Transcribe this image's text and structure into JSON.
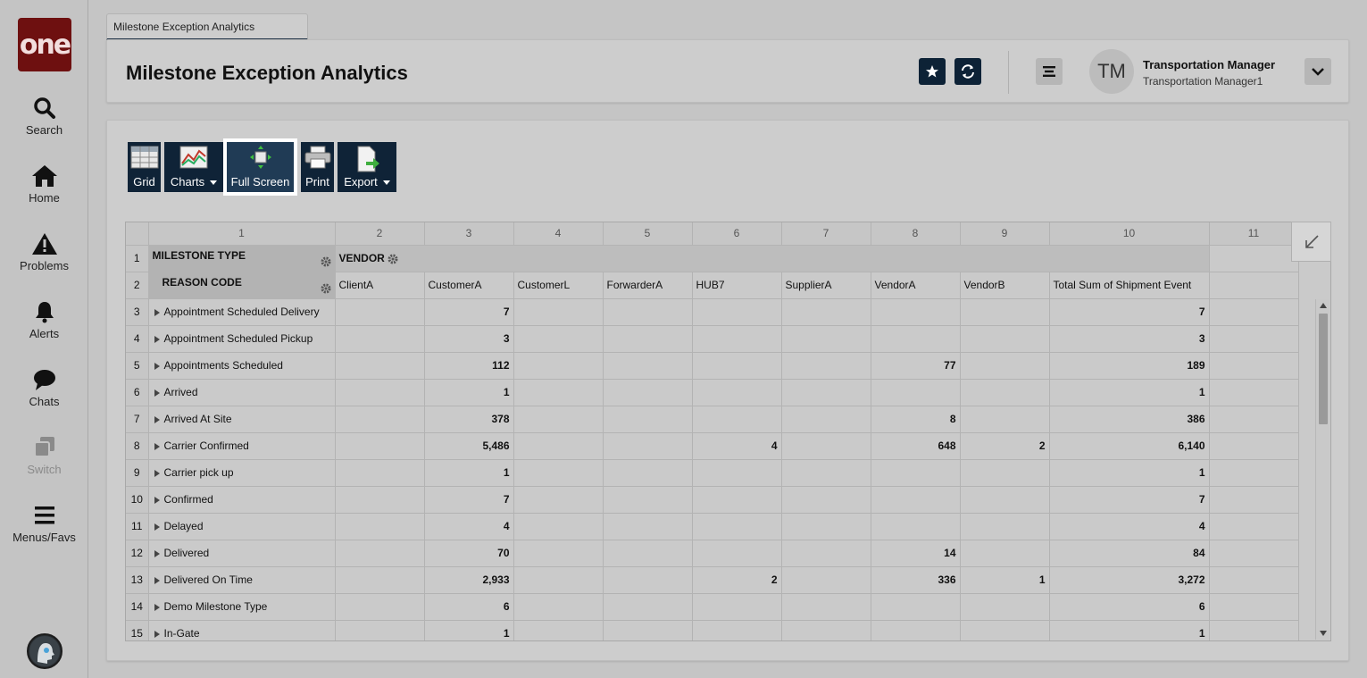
{
  "nav": {
    "logo": "one",
    "items": [
      {
        "label": "Search",
        "icon": "search-icon"
      },
      {
        "label": "Home",
        "icon": "home-icon"
      },
      {
        "label": "Problems",
        "icon": "warning-icon"
      },
      {
        "label": "Alerts",
        "icon": "bell-icon"
      },
      {
        "label": "Chats",
        "icon": "chat-icon"
      },
      {
        "label": "Switch",
        "icon": "switch-icon"
      },
      {
        "label": "Menus/Favs",
        "icon": "menu-icon"
      }
    ]
  },
  "tab": {
    "label": "Milestone Exception Analytics"
  },
  "header": {
    "title": "Milestone Exception Analytics",
    "user_initials": "TM",
    "user_role": "Transportation Manager",
    "user_name": "Transportation Manager1"
  },
  "toolbar": {
    "grid": "Grid",
    "charts": "Charts",
    "full_screen": "Full Screen",
    "print": "Print",
    "export": "Export"
  },
  "grid": {
    "col_numbers": [
      "1",
      "2",
      "3",
      "4",
      "5",
      "6",
      "7",
      "8",
      "9",
      "10",
      "11"
    ],
    "row_header_label": "MILESTONE TYPE",
    "reason_code_label": "REASON CODE",
    "column_header_label": "VENDOR",
    "columns": [
      "ClientA",
      "CustomerA",
      "CustomerL",
      "ForwarderA",
      "HUB7",
      "SupplierA",
      "VendorA",
      "VendorB",
      "Total Sum of Shipment Event"
    ],
    "rows": [
      {
        "num": "3",
        "label": "Appointment Scheduled Delivery",
        "values": [
          "",
          "7",
          "",
          "",
          "",
          "",
          "",
          "",
          "7"
        ]
      },
      {
        "num": "4",
        "label": "Appointment Scheduled Pickup",
        "values": [
          "",
          "3",
          "",
          "",
          "",
          "",
          "",
          "",
          "3"
        ]
      },
      {
        "num": "5",
        "label": "Appointments Scheduled",
        "values": [
          "",
          "112",
          "",
          "",
          "",
          "",
          "77",
          "",
          "189"
        ]
      },
      {
        "num": "6",
        "label": "Arrived",
        "values": [
          "",
          "1",
          "",
          "",
          "",
          "",
          "",
          "",
          "1"
        ]
      },
      {
        "num": "7",
        "label": "Arrived At Site",
        "values": [
          "",
          "378",
          "",
          "",
          "",
          "",
          "8",
          "",
          "386"
        ]
      },
      {
        "num": "8",
        "label": "Carrier Confirmed",
        "values": [
          "",
          "5,486",
          "",
          "",
          "4",
          "",
          "648",
          "2",
          "6,140"
        ]
      },
      {
        "num": "9",
        "label": "Carrier pick up",
        "values": [
          "",
          "1",
          "",
          "",
          "",
          "",
          "",
          "",
          "1"
        ]
      },
      {
        "num": "10",
        "label": "Confirmed",
        "values": [
          "",
          "7",
          "",
          "",
          "",
          "",
          "",
          "",
          "7"
        ]
      },
      {
        "num": "11",
        "label": "Delayed",
        "values": [
          "",
          "4",
          "",
          "",
          "",
          "",
          "",
          "",
          "4"
        ]
      },
      {
        "num": "12",
        "label": "Delivered",
        "values": [
          "",
          "70",
          "",
          "",
          "",
          "",
          "14",
          "",
          "84"
        ]
      },
      {
        "num": "13",
        "label": "Delivered On Time",
        "values": [
          "",
          "2,933",
          "",
          "",
          "2",
          "",
          "336",
          "1",
          "3,272"
        ]
      },
      {
        "num": "14",
        "label": "Demo Milestone Type",
        "values": [
          "",
          "6",
          "",
          "",
          "",
          "",
          "",
          "",
          "6"
        ]
      },
      {
        "num": "15",
        "label": "In-Gate",
        "values": [
          "",
          "1",
          "",
          "",
          "",
          "",
          "",
          "",
          "1"
        ]
      }
    ]
  }
}
